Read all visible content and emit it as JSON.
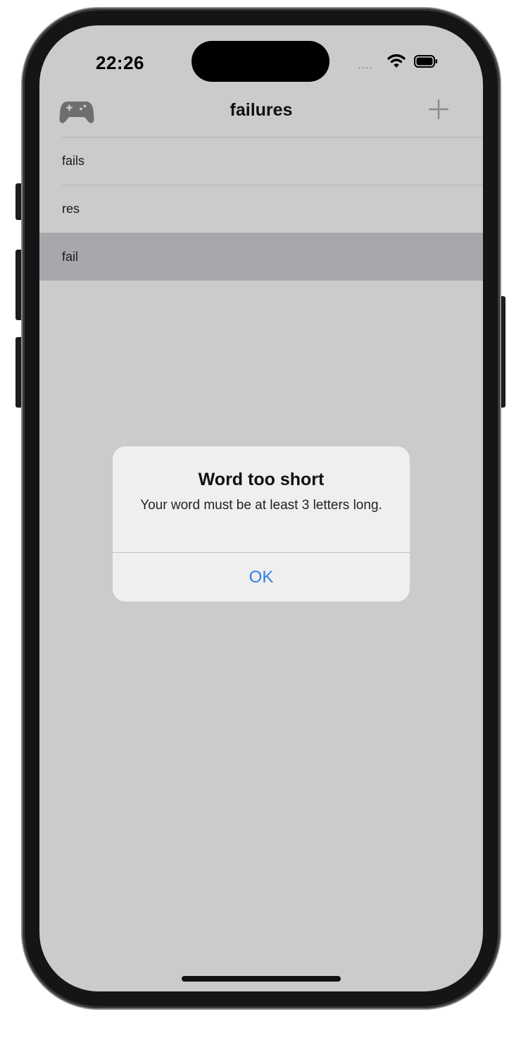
{
  "status_bar": {
    "time": "22:26",
    "signal_text": "....",
    "wifi_icon": "wifi-icon",
    "battery_icon": "battery-icon"
  },
  "nav": {
    "title": "failures",
    "left_icon": "gamepad-icon",
    "right_icon": "plus-icon"
  },
  "list": {
    "items": [
      {
        "label": "fails"
      },
      {
        "label": "res"
      },
      {
        "label": "fail"
      }
    ],
    "selected_index": 2
  },
  "alert": {
    "title": "Word too short",
    "message": "Your word must be at least 3 letters long.",
    "button_label": "OK"
  },
  "colors": {
    "background": "#cbcbcb",
    "selected_row": "#a8a7ab",
    "accent": "#2f7fe6"
  }
}
